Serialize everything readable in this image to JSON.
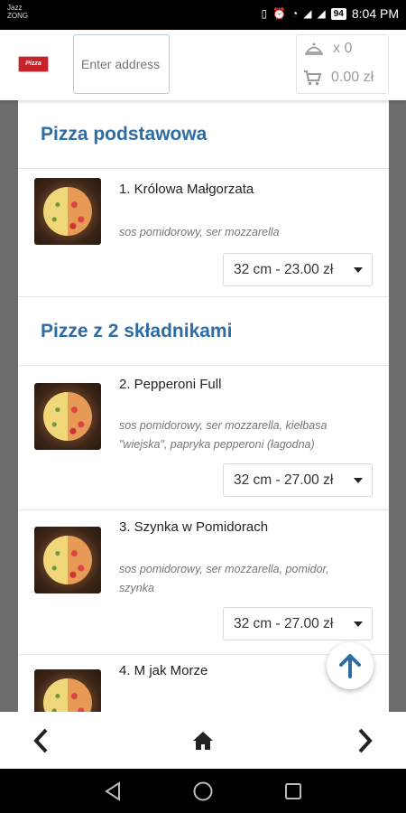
{
  "status_bar": {
    "carrier_line1": "Jazz",
    "carrier_line2": "ZONG",
    "battery": "94",
    "time": "8:04 PM"
  },
  "header": {
    "logo_text": "Pizza",
    "address_placeholder": "Enter address",
    "cart_items_count": "x 0",
    "cart_total": "0.00 zł"
  },
  "menu": {
    "sections": [
      {
        "title": "Pizza podstawowa",
        "items": [
          {
            "name": "1. Królowa Małgorzata",
            "desc": "sos pomidorowy, ser mozzarella",
            "size": "32 cm - 23.00 zł"
          }
        ]
      },
      {
        "title": "Pizze z 2 składnikami",
        "items": [
          {
            "name": "2. Pepperoni Full",
            "desc": "sos pomidorowy, ser mozzarella, kiełbasa \"wiejska\", papryka pepperoni (łagodna)",
            "size": "32 cm - 27.00 zł"
          },
          {
            "name": "3. Szynka w Pomidorach",
            "desc": "sos pomidorowy, ser mozzarella, pomidor, szynka",
            "size": "32 cm - 27.00 zł"
          },
          {
            "name": "4. M jak Morze",
            "desc": "",
            "size": ""
          }
        ]
      }
    ]
  },
  "colors": {
    "section_title": "#2e6da4",
    "fab_arrow": "#2e6da4"
  },
  "icons": {
    "fab": "arrow-up-icon",
    "nav_back": "chevron-left-icon",
    "nav_home": "home-icon",
    "nav_forward": "chevron-right-icon"
  }
}
